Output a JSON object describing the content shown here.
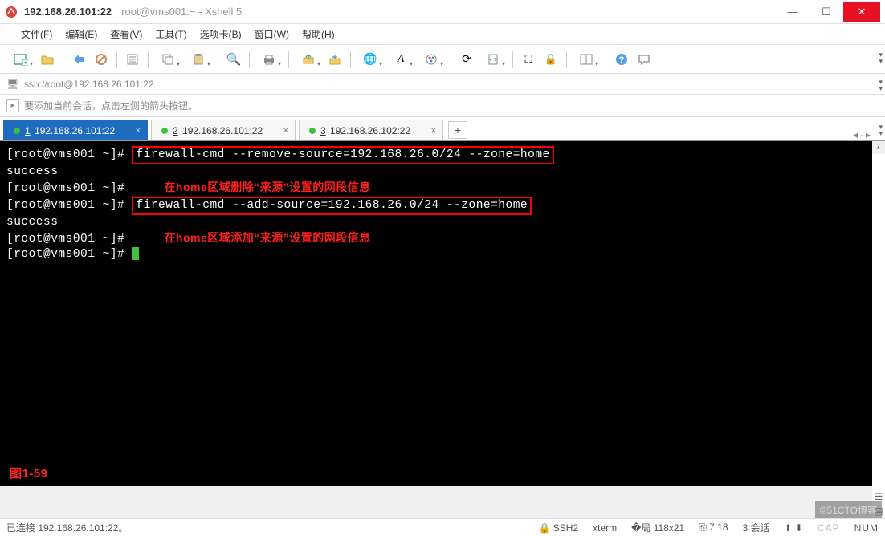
{
  "title": {
    "main": "192.168.26.101:22",
    "sub": "root@vms001:~ - Xshell 5"
  },
  "menu": {
    "file": "文件(F)",
    "edit": "编辑(E)",
    "view": "查看(V)",
    "tools": "工具(T)",
    "tabs": "选项卡(B)",
    "window": "窗口(W)",
    "help": "帮助(H)"
  },
  "address": {
    "url": "ssh://root@192.168.26.101:22"
  },
  "hint": {
    "text": "要添加当前会话，点击左侧的箭头按钮。"
  },
  "tabs": [
    {
      "num": "1",
      "label": "192.168.26.101:22",
      "active": true
    },
    {
      "num": "2",
      "label": "192.168.26.101:22",
      "active": false
    },
    {
      "num": "3",
      "label": "192.168.26.102:22",
      "active": false
    }
  ],
  "terminal": {
    "prompt1": "[root@vms001 ~]# ",
    "cmd1": "firewall-cmd --remove-source=192.168.26.0/24 --zone=home",
    "out1": "success",
    "ann1": "在home区域删除“来源”设置的网段信息",
    "prompt2": "[root@vms001 ~]# ",
    "cmd2": "firewall-cmd --add-source=192.168.26.0/24 --zone=home",
    "out2": "success",
    "ann2": "在home区域添加“来源”设置的网段信息",
    "prompt3": "[root@vms001 ~]# ",
    "prompt4": "[root@vms001 ~]# ",
    "figure": "图1-59"
  },
  "status": {
    "left": "已连接 192.168.26.101:22。",
    "ssh": "SSH2",
    "term": "xterm",
    "size": "118x21",
    "val": "7,18",
    "sessions": "3 会话",
    "cap": "CAP",
    "num": "NUM"
  },
  "watermark": "©51CTO博客",
  "icons": {
    "lock": "🔒",
    "globe": "🌐",
    "font": "A",
    "palette": "🎨",
    "refresh": "⟳",
    "search": "🔍",
    "fullscreen": "⛶",
    "help": "?",
    "chat": "💬"
  }
}
